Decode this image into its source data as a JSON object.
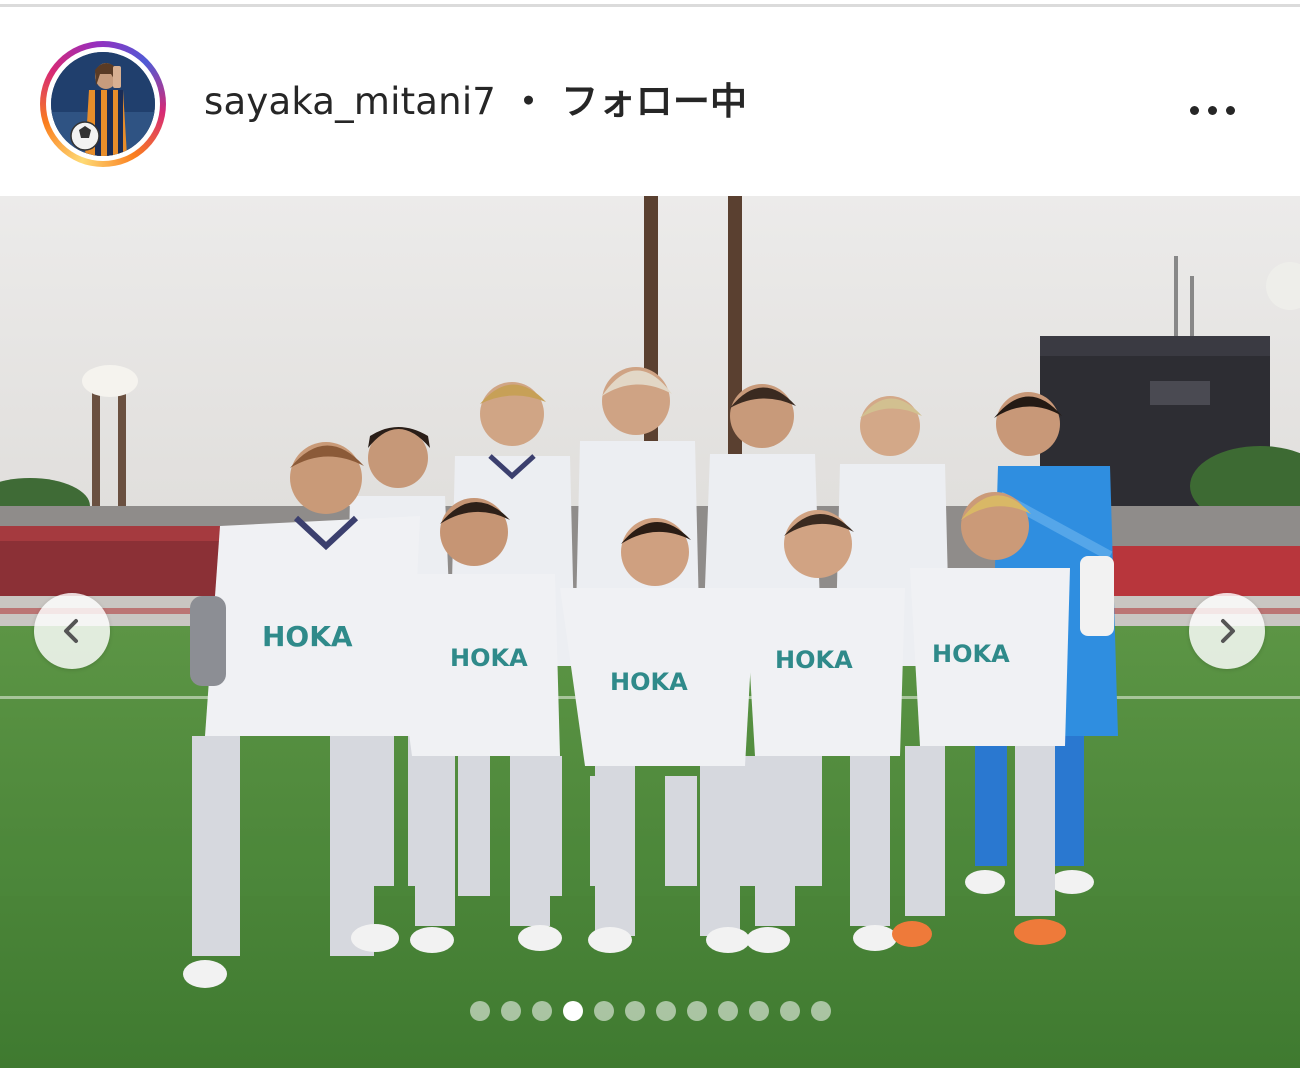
{
  "post": {
    "username": "sayaka_mitani7",
    "separator": "・",
    "follow_status": "フォロー中",
    "more_icon": "more-horizontal-icon"
  },
  "carousel": {
    "prev_icon": "chevron-left-icon",
    "next_icon": "chevron-right-icon",
    "total_slides": 12,
    "active_slide": 4
  },
  "photo": {
    "sponsor_text": "HOKA"
  },
  "colors": {
    "text": "#262626",
    "divider": "#dbdbdb",
    "ring_gradient": [
      "#feda75",
      "#fa7e1e",
      "#d62976",
      "#962fbf",
      "#4f5bd5"
    ],
    "kit_white": "#eef0f4",
    "kit_trim": "#3b3f6e",
    "keeper_blue": "#2f8ee0",
    "pitch_green": "#4f8a3a"
  }
}
